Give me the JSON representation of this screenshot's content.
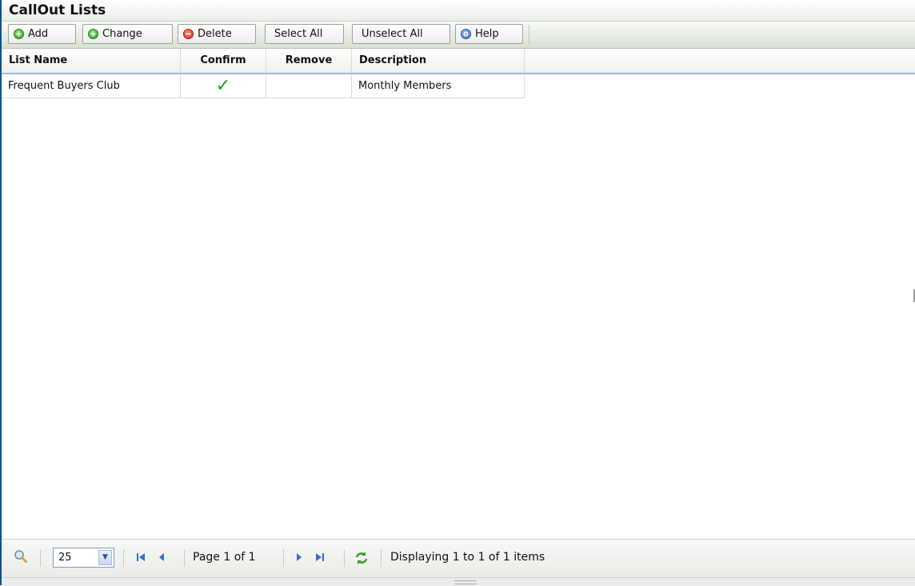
{
  "panel": {
    "title": "CallOut Lists"
  },
  "toolbar": {
    "add": "Add",
    "change": "Change",
    "delete": "Delete",
    "select_all": "Select All",
    "unselect_all": "Unselect All",
    "help": "Help"
  },
  "grid": {
    "columns": [
      "List Name",
      "Confirm",
      "Remove",
      "Description"
    ],
    "rows": [
      {
        "list_name": "Frequent Buyers Club",
        "confirm": "✓",
        "remove": "",
        "description": "Monthly Members"
      }
    ]
  },
  "pager": {
    "page_size": "25",
    "page_label": "Page 1 of 1",
    "status": "Displaying 1 to 1 of 1 items"
  },
  "icons": {
    "add": "plus-circle-icon",
    "change": "plus-circle-icon",
    "delete": "minus-circle-icon",
    "help": "help-circle-icon",
    "search": "magnifier-icon",
    "first": "first-page-icon",
    "prev": "prev-page-icon",
    "next": "next-page-icon",
    "last": "last-page-icon",
    "refresh": "refresh-icon"
  },
  "colors": {
    "accent_border": "#0b4f9e",
    "check": "#1aa31a",
    "header_underline": "#9bbcd6"
  }
}
